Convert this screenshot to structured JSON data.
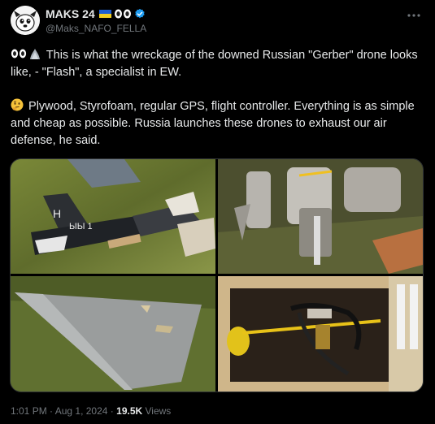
{
  "author": {
    "display_name": "MAKS 24",
    "handle": "@Maks_NAFO_FELLA"
  },
  "tweet": {
    "paragraph1": "This is what the wreckage of the downed Russian \"Gerber\" drone looks like, - \"Flash\", a specialist in EW.",
    "paragraph2": "Plywood, Styrofoam, regular GPS, flight controller. Everything is as simple and cheap as possible. Russia launches these drones to exhaust our air defense, he said."
  },
  "media": {
    "drone_marking": "Н",
    "drone_label": "ЫЫ 1"
  },
  "footer": {
    "time": "1:01 PM",
    "separator": "·",
    "date": "Aug 1, 2024",
    "views_count": "19.5K",
    "views_label": "Views"
  },
  "colors": {
    "background": "#000000",
    "text": "#e7e9ea",
    "secondary": "#71767b",
    "verified": "#1d9bf0"
  },
  "icons": [
    "avatar-image",
    "ukraine-flag-icon",
    "eyes-emoji-icon",
    "verified-badge-icon",
    "more-options-icon",
    "thinking-face-icon"
  ]
}
